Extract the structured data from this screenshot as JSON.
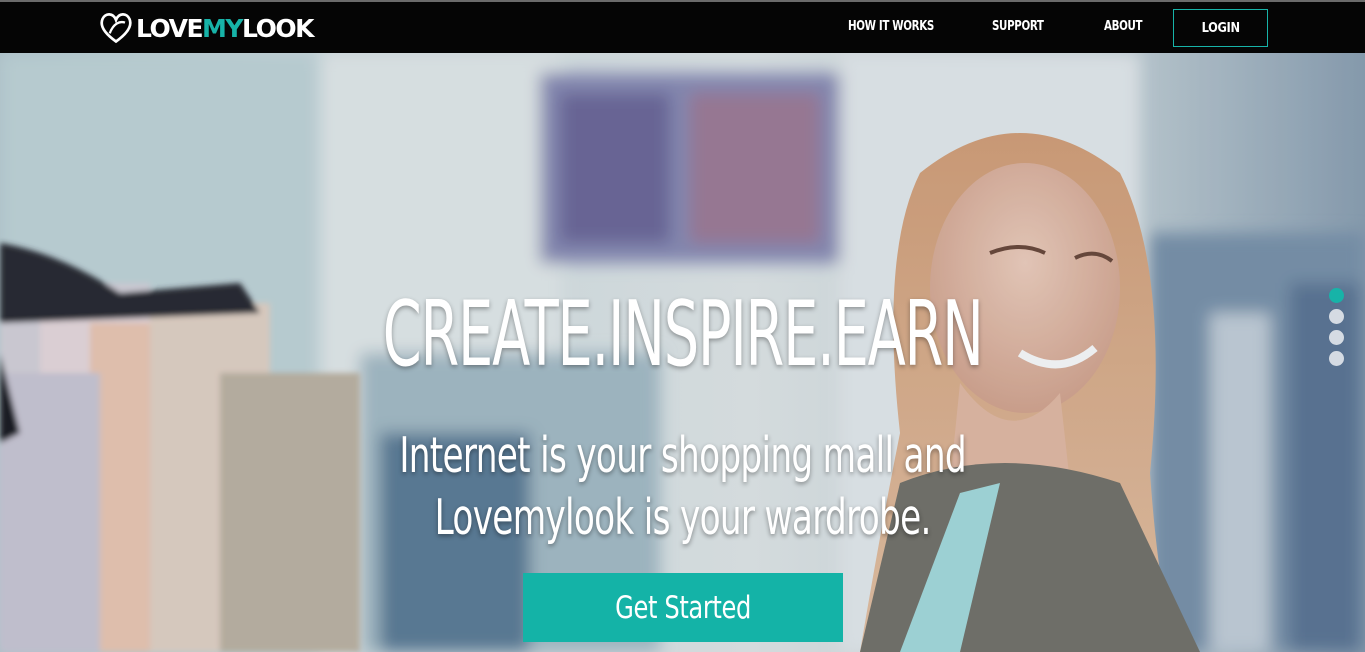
{
  "brand": {
    "logo_text_part1": "LOVE",
    "logo_text_part2": "MY",
    "logo_text_part3": "LOOK",
    "accent_color": "#17b3a8"
  },
  "nav": {
    "links": [
      "HOW IT WORKS",
      "SUPPORT",
      "ABOUT"
    ],
    "login_label": "LOGIN"
  },
  "hero": {
    "headline": "CREATE.INSPIRE.EARN",
    "subline_1": "Internet is your shopping mall and",
    "subline_2": "Lovemylook is your wardrobe.",
    "cta_label": "Get Started",
    "slider_count": 4,
    "active_slide": 1
  }
}
